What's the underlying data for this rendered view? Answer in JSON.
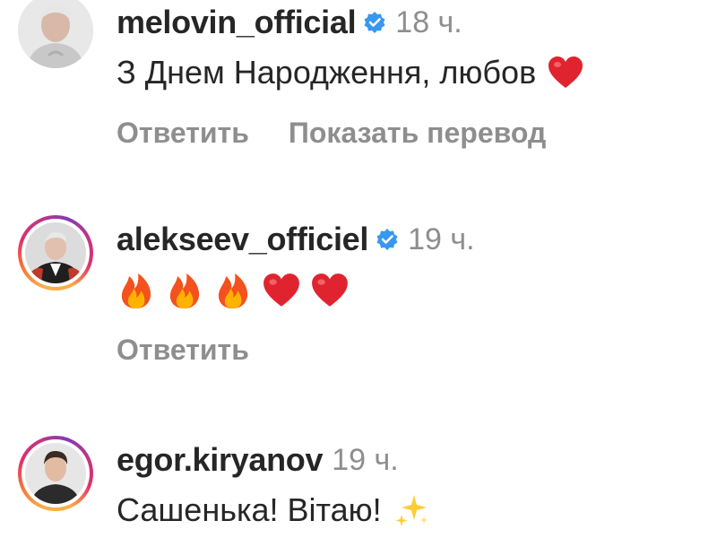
{
  "comments": [
    {
      "username": "melovin_official",
      "verified": true,
      "time": "18 ч.",
      "text": "З Днем Народження, любов",
      "emoji": [
        "heart-emoji"
      ],
      "actions": [
        "Ответить",
        "Показать перевод"
      ],
      "story_ring": false
    },
    {
      "username": "alekseev_officiel",
      "verified": true,
      "time": "19 ч.",
      "text": "",
      "emoji": [
        "fire-emoji",
        "fire-emoji",
        "fire-emoji",
        "heart-emoji",
        "heart-emoji"
      ],
      "actions": [
        "Ответить"
      ],
      "story_ring": true
    },
    {
      "username": "egor.kiryanov",
      "verified": false,
      "time": "19 ч.",
      "text": "Сашенька! Вітаю!",
      "emoji": [
        "sparkles-emoji"
      ],
      "actions": [],
      "story_ring": true
    }
  ],
  "colors": {
    "text": "#262626",
    "muted": "#8e8e8e",
    "verified_blue": "#3897f0",
    "heart_red": "#e0242f"
  }
}
